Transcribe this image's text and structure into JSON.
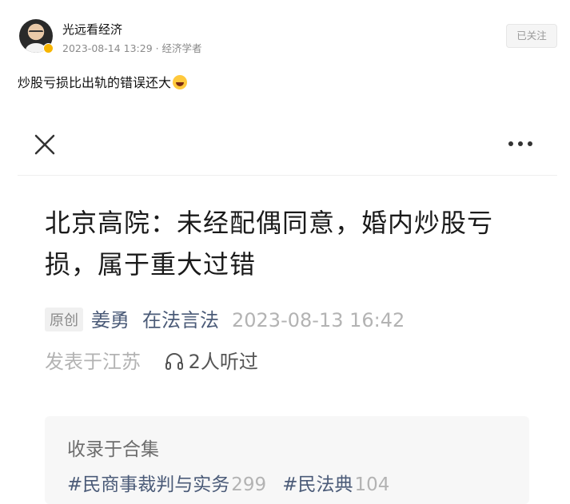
{
  "post": {
    "author_name": "光远看经济",
    "meta": "2023-08-14 13:29 · 经济学者",
    "follow_label": "已关注",
    "text": "炒股亏损比出轨的错误还大"
  },
  "article": {
    "title": "北京高院：未经配偶同意，婚内炒股亏损，属于重大过错",
    "original_tag": "原创",
    "author": "姜勇",
    "account": "在法言法",
    "date": "2023-08-13 16:42",
    "location": "发表于江苏",
    "listen_count": "2人听过",
    "collection_label": "收录于合集",
    "collections": [
      {
        "tag": "#民商事裁判与实务",
        "count": "299"
      },
      {
        "tag": "#民法典",
        "count": "104"
      }
    ]
  },
  "icons": [
    "close-icon",
    "more-icon",
    "headphone-icon",
    "verified-icon",
    "grin-emoji-icon"
  ]
}
